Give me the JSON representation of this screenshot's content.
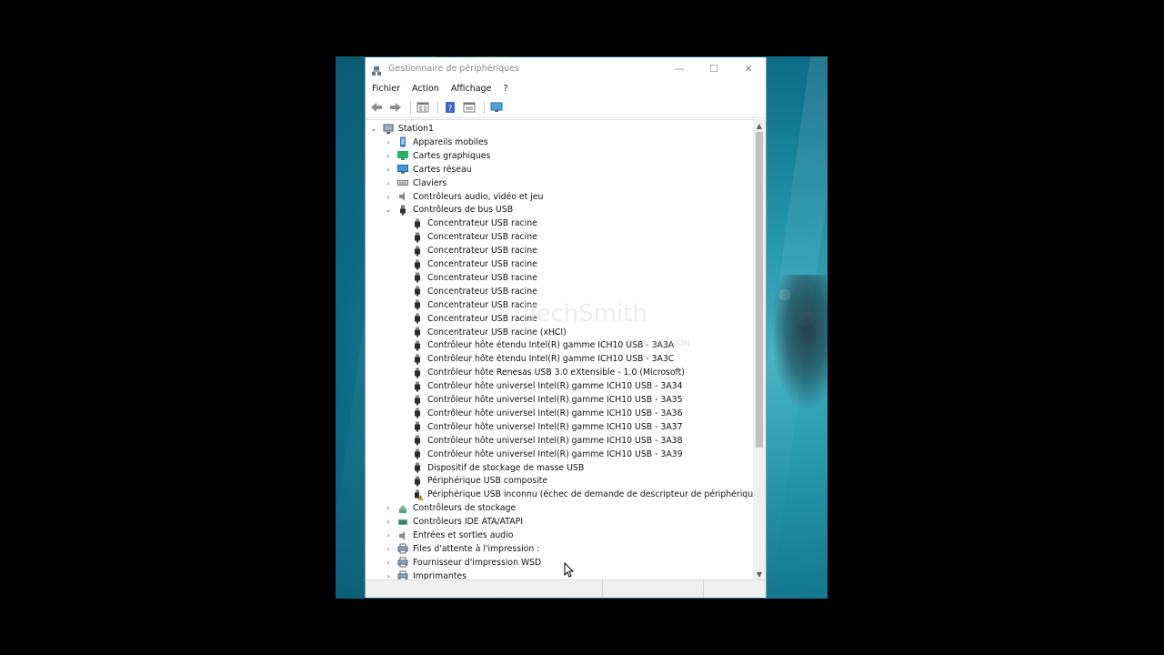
{
  "window": {
    "title": "Gestionnaire de périphériques",
    "controls": {
      "minimize": "—",
      "maximize": "☐",
      "close": "✕"
    }
  },
  "menu": [
    "Fichier",
    "Action",
    "Affichage",
    "?"
  ],
  "toolbar": [
    "back-arrow-icon",
    "forward-arrow-icon",
    "properties-icon",
    "help-icon",
    "details-icon",
    "monitor-icon"
  ],
  "tree": {
    "root": {
      "label": "Station1",
      "icon": "computer-icon",
      "expanded": true
    },
    "categories_before": [
      {
        "label": "Appareils mobiles",
        "icon": "mobile-icon"
      },
      {
        "label": "Cartes graphiques",
        "icon": "display-icon"
      },
      {
        "label": "Cartes réseau",
        "icon": "network-icon"
      },
      {
        "label": "Claviers",
        "icon": "keyboard-icon"
      },
      {
        "label": "Contrôleurs audio, vidéo et jeu",
        "icon": "speaker-icon"
      }
    ],
    "usb_category": {
      "label": "Contrôleurs de bus USB",
      "icon": "usb-icon",
      "expanded": true
    },
    "usb_children": [
      {
        "label": "Concentrateur USB racine",
        "warning": false
      },
      {
        "label": "Concentrateur USB racine",
        "warning": false
      },
      {
        "label": "Concentrateur USB racine",
        "warning": false
      },
      {
        "label": "Concentrateur USB racine",
        "warning": false
      },
      {
        "label": "Concentrateur USB racine",
        "warning": false
      },
      {
        "label": "Concentrateur USB racine",
        "warning": false
      },
      {
        "label": "Concentrateur USB racine",
        "warning": false
      },
      {
        "label": "Concentrateur USB racine",
        "warning": false
      },
      {
        "label": "Concentrateur USB racine (xHCI)",
        "warning": false
      },
      {
        "label": "Contrôleur hôte étendu Intel(R) gamme ICH10 USB - 3A3A",
        "warning": false
      },
      {
        "label": "Contrôleur hôte étendu Intel(R) gamme ICH10 USB - 3A3C",
        "warning": false
      },
      {
        "label": "Contrôleur hôte Renesas USB 3.0 eXtensible - 1.0 (Microsoft)",
        "warning": false
      },
      {
        "label": "Contrôleur hôte universel Intel(R) gamme ICH10 USB - 3A34",
        "warning": false
      },
      {
        "label": "Contrôleur hôte universel Intel(R) gamme ICH10 USB - 3A35",
        "warning": false
      },
      {
        "label": "Contrôleur hôte universel Intel(R) gamme ICH10 USB - 3A36",
        "warning": false
      },
      {
        "label": "Contrôleur hôte universel Intel(R) gamme ICH10 USB - 3A37",
        "warning": false
      },
      {
        "label": "Contrôleur hôte universel Intel(R) gamme ICH10 USB - 3A38",
        "warning": false
      },
      {
        "label": "Contrôleur hôte universel Intel(R) gamme ICH10 USB - 3A39",
        "warning": false
      },
      {
        "label": "Dispositif de stockage de masse USB",
        "warning": false
      },
      {
        "label": "Périphérique USB composite",
        "warning": false
      },
      {
        "label": "Périphérique USB inconnu (échec de demande de descripteur de périphérique)",
        "warning": true
      }
    ],
    "categories_after": [
      {
        "label": "Contrôleurs de stockage",
        "icon": "storage-icon"
      },
      {
        "label": "Contrôleurs IDE ATA/ATAPI",
        "icon": "ide-icon"
      },
      {
        "label": "Entrées et sorties audio",
        "icon": "speaker-icon"
      },
      {
        "label": "Files d'attente à l'impression :",
        "icon": "printer-icon"
      },
      {
        "label": "Fournisseur d'impression WSD",
        "icon": "printer-icon"
      },
      {
        "label": "Imprimantes",
        "icon": "printer-icon"
      }
    ]
  },
  "watermark": {
    "brand": "TechSmith",
    "tagline": "TRIAL VERSION"
  },
  "colors": {
    "accent": "#1f6fd0",
    "warning": "#f2c200",
    "desktop": "#1a8aa3"
  }
}
